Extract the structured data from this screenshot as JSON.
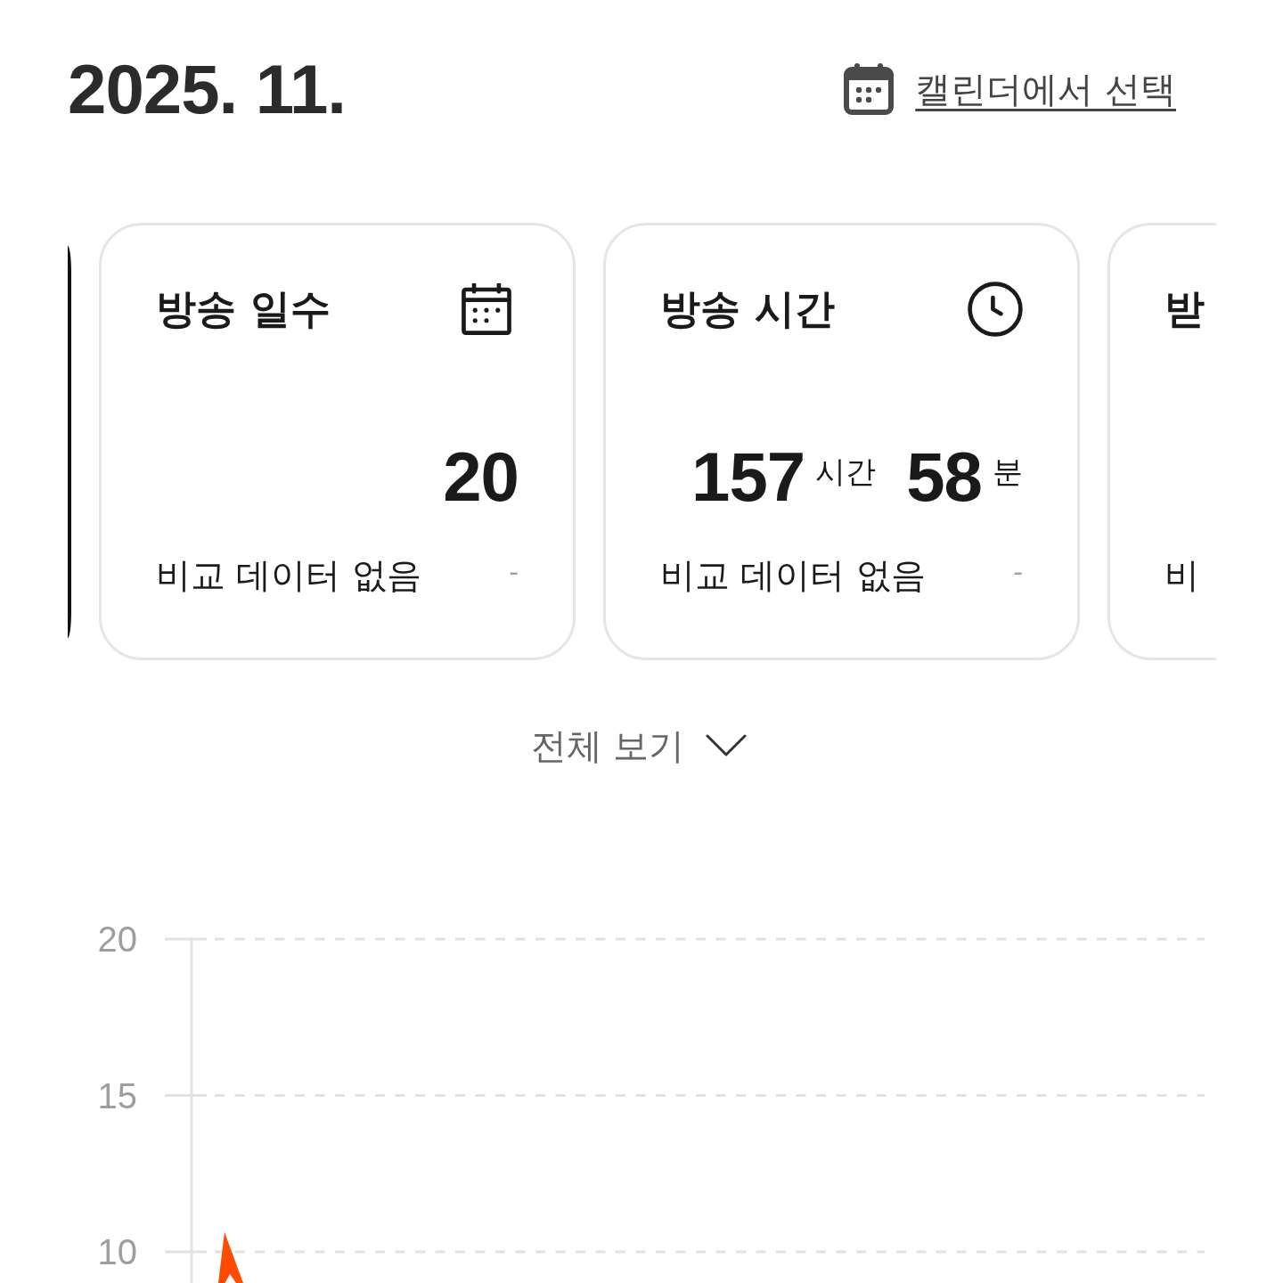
{
  "header": {
    "title": "2025. 11.",
    "calendar_link": "캘린더에서 선택"
  },
  "cards": [
    {
      "selected": true
    },
    {
      "selected": false,
      "title": "방송 일수",
      "value": [
        {
          "number": "20"
        }
      ],
      "comparison": "비교 데이터 없음",
      "change": "-"
    },
    {
      "selected": false,
      "title": "방송 시간",
      "value": [
        {
          "number": "157",
          "unit": "시간"
        },
        {
          "number": "58",
          "unit": "분"
        }
      ],
      "comparison": "비교 데이터 없음",
      "change": "-"
    },
    {
      "selected": false,
      "title": "받",
      "comparison": "비"
    }
  ],
  "expand_button": {
    "label": "전체 보기"
  },
  "chart": {
    "y_labels": [
      "20",
      "15",
      "10"
    ]
  }
}
